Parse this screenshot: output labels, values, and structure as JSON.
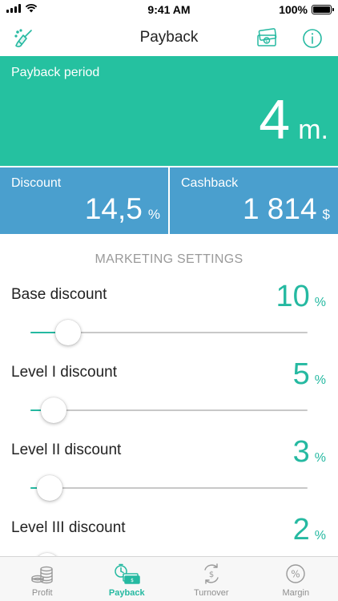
{
  "status_bar": {
    "time": "9:41 AM",
    "battery": "100%"
  },
  "nav": {
    "title": "Payback"
  },
  "payback": {
    "label": "Payback period",
    "value": "4",
    "unit": "m."
  },
  "discount": {
    "label": "Discount",
    "value": "14,5",
    "unit": "%"
  },
  "cashback": {
    "label": "Cashback",
    "value": "1 814",
    "unit": "$"
  },
  "marketing": {
    "title": "MARKETING SETTINGS",
    "settings": [
      {
        "label": "Base discount",
        "value": "10",
        "unit": "%",
        "slider_fraction": 0.135
      },
      {
        "label": "Level I discount",
        "value": "5",
        "unit": "%",
        "slider_fraction": 0.085
      },
      {
        "label": "Level II discount",
        "value": "3",
        "unit": "%",
        "slider_fraction": 0.07
      },
      {
        "label": "Level III discount",
        "value": "2",
        "unit": "%",
        "slider_fraction": 0.06
      }
    ]
  },
  "tabs": [
    {
      "label": "Profit",
      "icon": "coins-icon",
      "active": false
    },
    {
      "label": "Payback",
      "icon": "payback-icon",
      "active": true
    },
    {
      "label": "Turnover",
      "icon": "turnover-icon",
      "active": false
    },
    {
      "label": "Margin",
      "icon": "margin-icon",
      "active": false
    }
  ],
  "colors": {
    "accent": "#25c1a0",
    "blue": "#4a9fce",
    "teal_text": "#25b9a1",
    "inactive": "#8e8e8e"
  }
}
